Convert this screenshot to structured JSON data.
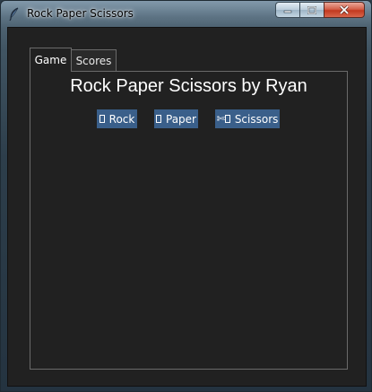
{
  "window": {
    "title": "Rock Paper Scissors",
    "icon": "feather-icon"
  },
  "tabs": [
    {
      "label": "Game",
      "selected": true
    },
    {
      "label": "Scores",
      "selected": false
    }
  ],
  "game": {
    "heading": "Rock Paper Scissors by Ryan",
    "buttons": {
      "rock": "Rock",
      "paper": "Paper",
      "scissors_symbol": "✄",
      "scissors": "Scissors"
    }
  },
  "colors": {
    "background": "#212121",
    "button": "#3a5f8a",
    "text": "#ffffff"
  }
}
